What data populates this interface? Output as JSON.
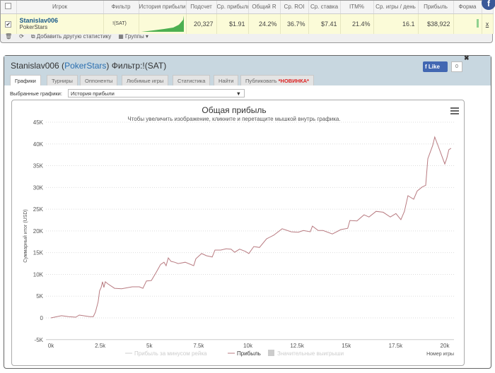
{
  "stats_table": {
    "headers": [
      "Игрок",
      "Фильтр",
      "История прибыли",
      "Подсчет",
      "Ср. прибыль",
      "Общий R",
      "Ср. ROI",
      "Ср. ставка",
      "ITM%",
      "Ср. игры / день",
      "Прибыль",
      "Форма"
    ],
    "row": {
      "player": "Stanislav006",
      "network": "PokerStars",
      "filter": "!(SAT)",
      "count": "20,327",
      "avg_profit": "$1.91",
      "total_roi": "24.2%",
      "avg_roi": "36.7%",
      "avg_stake": "$7.41",
      "itm": "21.4%",
      "games_per_day": "16.1",
      "profit": "$38,922",
      "remove": "x"
    },
    "footer": {
      "add_stat": "Добавить другую статистику",
      "groups": "Группы ▾"
    }
  },
  "dialog": {
    "player": "Stanislav006",
    "network": "PokerStars",
    "filter": "Фильтр:!(SAT)",
    "tabs": [
      "Графики",
      "Турниры",
      "Оппоненты",
      "Любимые игры",
      "Статистика",
      "Найти",
      "Публиковать"
    ],
    "new_badge": "*НОВИНКА*",
    "like": "Like",
    "like_count": "0",
    "selected_label": "Выбранные графики:",
    "selected_value": "История прибыли"
  },
  "chart_data": {
    "type": "line",
    "title": "Общая прибыль",
    "subtitle": "Чтобы увеличить изображение, кликните и перетащите мышкой внутрь графика.",
    "xlabel": "Номер игры",
    "ylabel": "Суммарный итог (USD)",
    "xlim": [
      0,
      20500
    ],
    "ylim": [
      -5000,
      45000
    ],
    "xticks": [
      "0k",
      "2.5k",
      "5k",
      "7.5k",
      "10k",
      "12.5k",
      "15k",
      "17.5k",
      "20k"
    ],
    "yticks": [
      "45K",
      "40K",
      "35K",
      "30K",
      "25K",
      "20K",
      "15K",
      "10K",
      "5K",
      "0",
      "-5K"
    ],
    "legend": [
      "Прибыль за минусом рейка",
      "Прибыль",
      "Значительные выигрыши"
    ],
    "series": [
      {
        "name": "Прибыль",
        "color": "#b87a80",
        "points": [
          [
            0,
            0
          ],
          [
            540,
            500
          ],
          [
            900,
            300
          ],
          [
            1260,
            160
          ],
          [
            1440,
            650
          ],
          [
            1970,
            300
          ],
          [
            2150,
            300
          ],
          [
            2260,
            1300
          ],
          [
            2400,
            3700
          ],
          [
            2470,
            6200
          ],
          [
            2550,
            7000
          ],
          [
            2620,
            8300
          ],
          [
            2690,
            7000
          ],
          [
            2760,
            8300
          ],
          [
            2900,
            7800
          ],
          [
            3230,
            6800
          ],
          [
            3590,
            6700
          ],
          [
            4130,
            7150
          ],
          [
            4490,
            7150
          ],
          [
            4670,
            6800
          ],
          [
            4850,
            8500
          ],
          [
            5100,
            8600
          ],
          [
            5310,
            10200
          ],
          [
            5460,
            11400
          ],
          [
            5570,
            12300
          ],
          [
            5740,
            12800
          ],
          [
            5850,
            12000
          ],
          [
            5960,
            13800
          ],
          [
            6100,
            13000
          ],
          [
            6280,
            12800
          ],
          [
            6460,
            12500
          ],
          [
            6820,
            12800
          ],
          [
            7250,
            12000
          ],
          [
            7360,
            13600
          ],
          [
            7650,
            14800
          ],
          [
            7900,
            14300
          ],
          [
            8190,
            14000
          ],
          [
            8330,
            15600
          ],
          [
            8620,
            15600
          ],
          [
            8900,
            15900
          ],
          [
            9150,
            15800
          ],
          [
            9330,
            15100
          ],
          [
            9580,
            15800
          ],
          [
            9870,
            15300
          ],
          [
            10050,
            14800
          ],
          [
            10300,
            16400
          ],
          [
            10590,
            16200
          ],
          [
            10950,
            18200
          ],
          [
            11310,
            19000
          ],
          [
            11740,
            20500
          ],
          [
            12200,
            19800
          ],
          [
            12560,
            19700
          ],
          [
            12820,
            20100
          ],
          [
            13170,
            19800
          ],
          [
            13280,
            21100
          ],
          [
            13570,
            20100
          ],
          [
            13820,
            20100
          ],
          [
            14290,
            19300
          ],
          [
            14720,
            20300
          ],
          [
            15070,
            20600
          ],
          [
            15180,
            22400
          ],
          [
            15540,
            22300
          ],
          [
            15900,
            23700
          ],
          [
            16150,
            23200
          ],
          [
            16510,
            24500
          ],
          [
            16870,
            24300
          ],
          [
            17230,
            23200
          ],
          [
            17520,
            24000
          ],
          [
            17770,
            22600
          ],
          [
            17950,
            24500
          ],
          [
            18130,
            28100
          ],
          [
            18420,
            27300
          ],
          [
            18600,
            29200
          ],
          [
            18850,
            30100
          ],
          [
            19030,
            30500
          ],
          [
            19140,
            36600
          ],
          [
            19390,
            39700
          ],
          [
            19490,
            41600
          ],
          [
            19640,
            39800
          ],
          [
            20000,
            35400
          ],
          [
            20100,
            36700
          ],
          [
            20210,
            38700
          ],
          [
            20320,
            39000
          ]
        ]
      }
    ]
  }
}
